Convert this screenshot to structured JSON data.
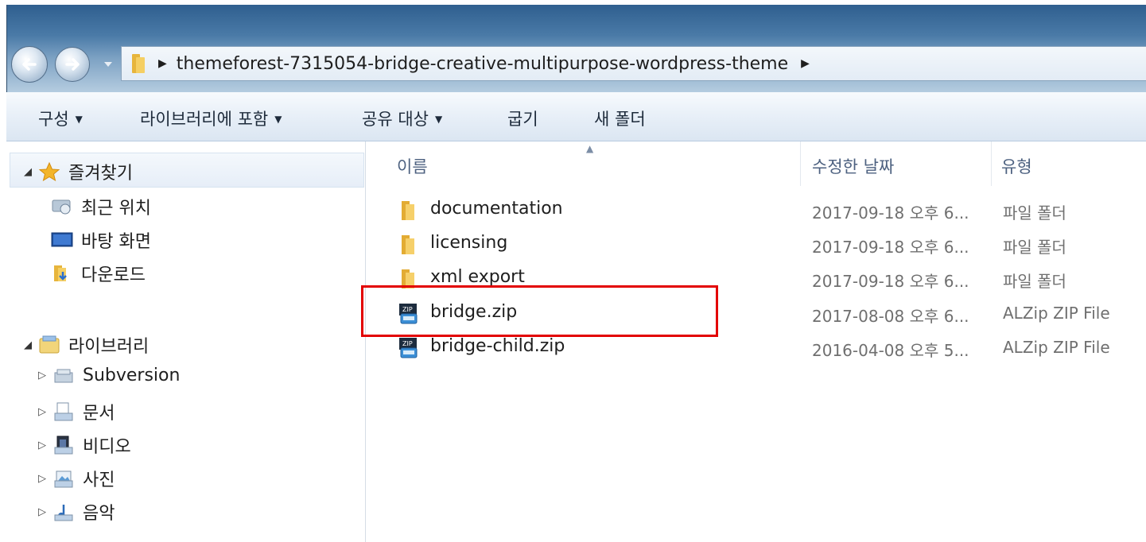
{
  "address": {
    "path": "themeforest-7315054-bridge-creative-multipurpose-wordpress-theme"
  },
  "toolbar": {
    "organize": "구성",
    "include_in_library": "라이브러리에 포함",
    "share_with": "공유 대상",
    "burn": "굽기",
    "new_folder": "새 폴더"
  },
  "nav": {
    "favorites": "즐겨찾기",
    "recent_places": "최근 위치",
    "desktop": "바탕 화면",
    "downloads": "다운로드",
    "libraries": "라이브러리",
    "library_items": [
      "Subversion",
      "문서",
      "비디오",
      "사진",
      "음악"
    ]
  },
  "columns": {
    "name": "이름",
    "date_modified": "수정한 날짜",
    "type": "유형"
  },
  "files": [
    {
      "name": "documentation",
      "date": "2017-09-18 오후 6...",
      "type": "파일 폴더",
      "icon": "folder-icon"
    },
    {
      "name": "licensing",
      "date": "2017-09-18 오후 6...",
      "type": "파일 폴더",
      "icon": "folder-icon"
    },
    {
      "name": "xml export",
      "date": "2017-09-18 오후 6...",
      "type": "파일 폴더",
      "icon": "folder-icon"
    },
    {
      "name": "bridge.zip",
      "date": "2017-08-08 오후 6...",
      "type": "ALZip ZIP File",
      "icon": "zip-file-icon"
    },
    {
      "name": "bridge-child.zip",
      "date": "2016-04-08 오후 5...",
      "type": "ALZip ZIP File",
      "icon": "zip-file-icon"
    }
  ],
  "colors": {
    "highlight": "#e30000",
    "titlebar": "#2f5f8f",
    "toolbar": "#e6eef7"
  }
}
